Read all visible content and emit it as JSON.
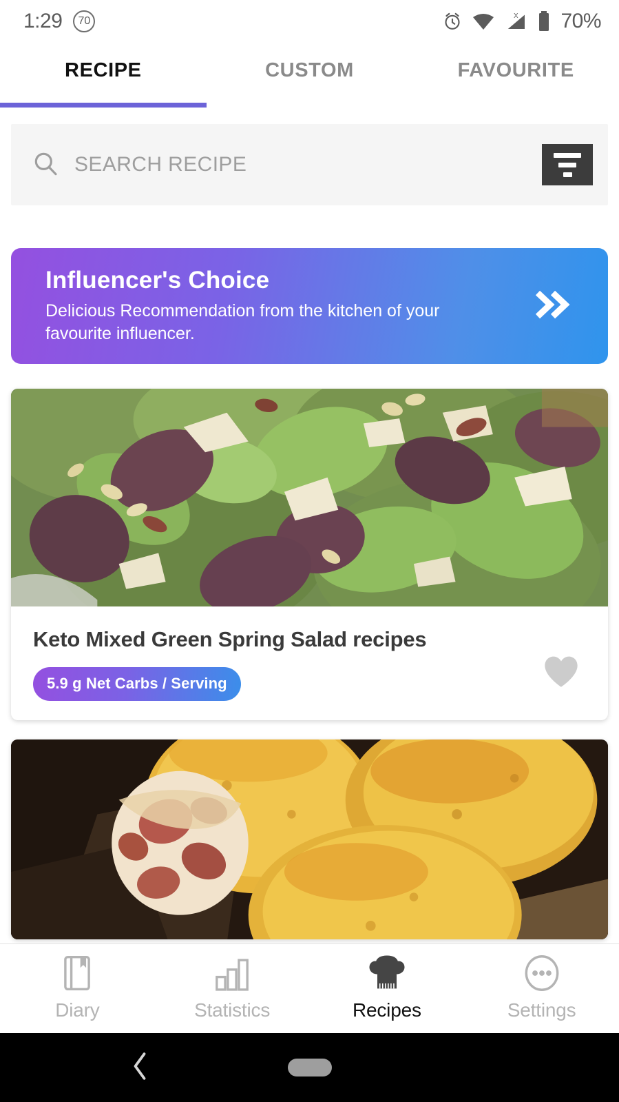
{
  "status_bar": {
    "time": "1:29",
    "badge_value": "70",
    "battery_percent": "70%",
    "icons": [
      "alarm-clock-icon",
      "wifi-icon",
      "cellular-signal-x-icon",
      "battery-icon"
    ]
  },
  "tabs": [
    {
      "label": "RECIPE",
      "active": true
    },
    {
      "label": "CUSTOM",
      "active": false
    },
    {
      "label": "FAVOURITE",
      "active": false
    }
  ],
  "search": {
    "placeholder": "SEARCH RECIPE",
    "value": "",
    "icon": "search-icon",
    "filter_icon": "filter-icon"
  },
  "banner": {
    "title": "Influencer's Choice",
    "subtitle": "Delicious Recommendation from the kitchen of your favourite influencer.",
    "arrow_icon": "double-chevron-right-icon",
    "gradient_start": "#9450e0",
    "gradient_end": "#2f94ed"
  },
  "recipes": [
    {
      "title": "Keto Mixed Green Spring Salad recipes",
      "carbs_badge": "5.9 g Net Carbs / Serving",
      "favourite_icon": "heart-icon",
      "favourited": false,
      "image_alt": "mixed green spring salad with cheese shavings and pine nuts"
    },
    {
      "title": "",
      "carbs_badge": "",
      "favourite_icon": "heart-icon",
      "favourited": false,
      "image_alt": "golden cheese bacon biscuits on a dark wooden board"
    }
  ],
  "bottom_nav": [
    {
      "label": "Diary",
      "icon": "book-icon",
      "active": false
    },
    {
      "label": "Statistics",
      "icon": "bar-chart-icon",
      "active": false
    },
    {
      "label": "Recipes",
      "icon": "chef-hat-icon",
      "active": true
    },
    {
      "label": "Settings",
      "icon": "more-circle-icon",
      "active": false
    }
  ],
  "android_nav": {
    "back_icon": "back-chevron-icon",
    "home_icon": "home-pill-icon"
  },
  "colors": {
    "accent_purple": "#6c63d8",
    "badge_purple": "#9450e0",
    "badge_blue": "#3b8eea",
    "filter_dark": "#3c3c3c",
    "heart_gray": "#cccccc"
  }
}
